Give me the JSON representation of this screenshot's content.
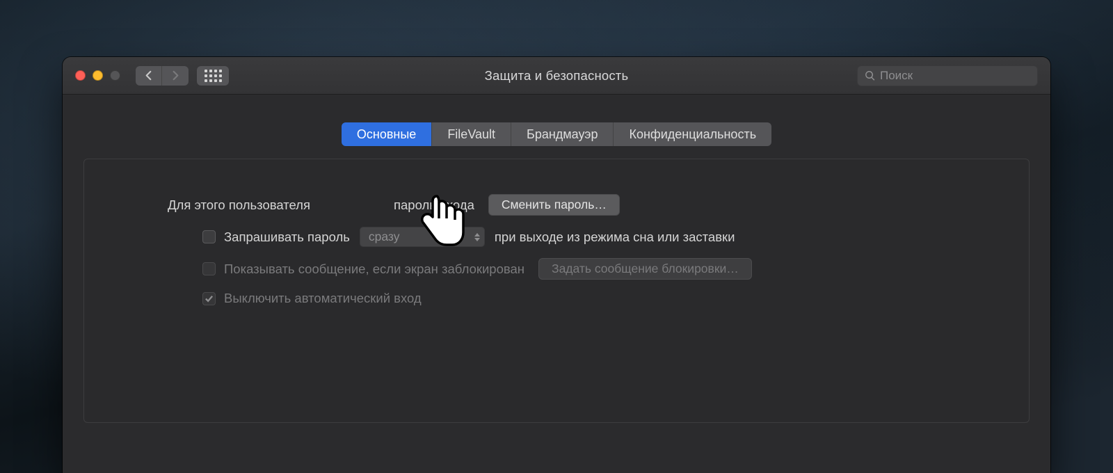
{
  "window_title": "Защита и безопасность",
  "search": {
    "placeholder": "Поиск"
  },
  "tabs": [
    {
      "label": "Основные",
      "active": true
    },
    {
      "label": "FileVault",
      "active": false
    },
    {
      "label": "Брандмауэр",
      "active": false
    },
    {
      "label": "Конфиденциальность",
      "active": false
    }
  ],
  "general": {
    "password_set_prefix": "Для этого пользователя",
    "password_set_suffix": "пароль входа",
    "change_password_button": "Сменить пароль…",
    "require_password_label": "Запрашивать пароль",
    "require_password_delay": "сразу",
    "require_password_after": "при выходе из режима сна или заставки",
    "show_message_label": "Показывать сообщение, если экран заблокирован",
    "set_lock_message_button": "Задать сообщение блокировки…",
    "disable_auto_login_label": "Выключить автоматический вход"
  }
}
